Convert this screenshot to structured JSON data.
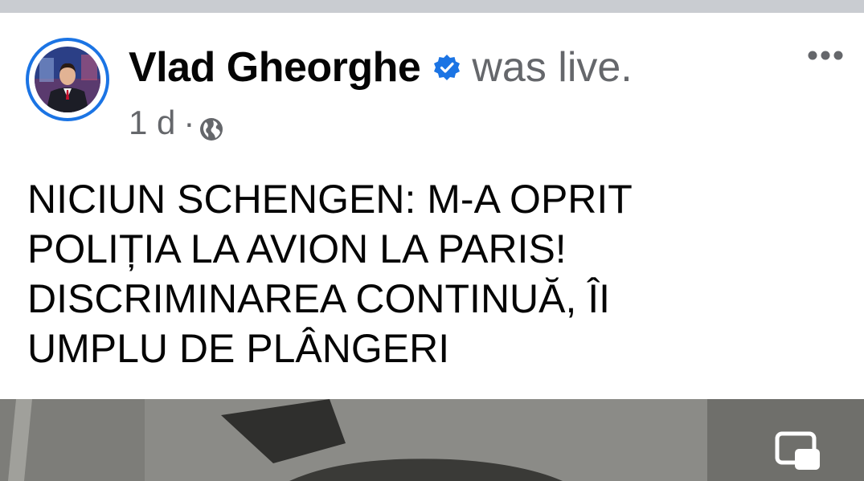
{
  "post": {
    "author": "Vlad Gheorghe",
    "action": "was live.",
    "time": "1 d",
    "separator": "·",
    "text": "NICIUN SCHENGEN: M-A OPRIT\nPOLIȚIA LA AVION LA PARIS!\nDISCRIMINAREA CONTINUĂ, ÎI\nUMPLU DE PLÂNGERI"
  },
  "icons": {
    "verified": "verified-badge-icon",
    "privacy": "globe-icon",
    "more": "more-options-icon",
    "pip": "picture-in-picture-icon"
  },
  "colors": {
    "accent": "#1b74e4",
    "text_primary": "#050505",
    "text_secondary": "#65676b",
    "divider": "#c9ccd1"
  }
}
